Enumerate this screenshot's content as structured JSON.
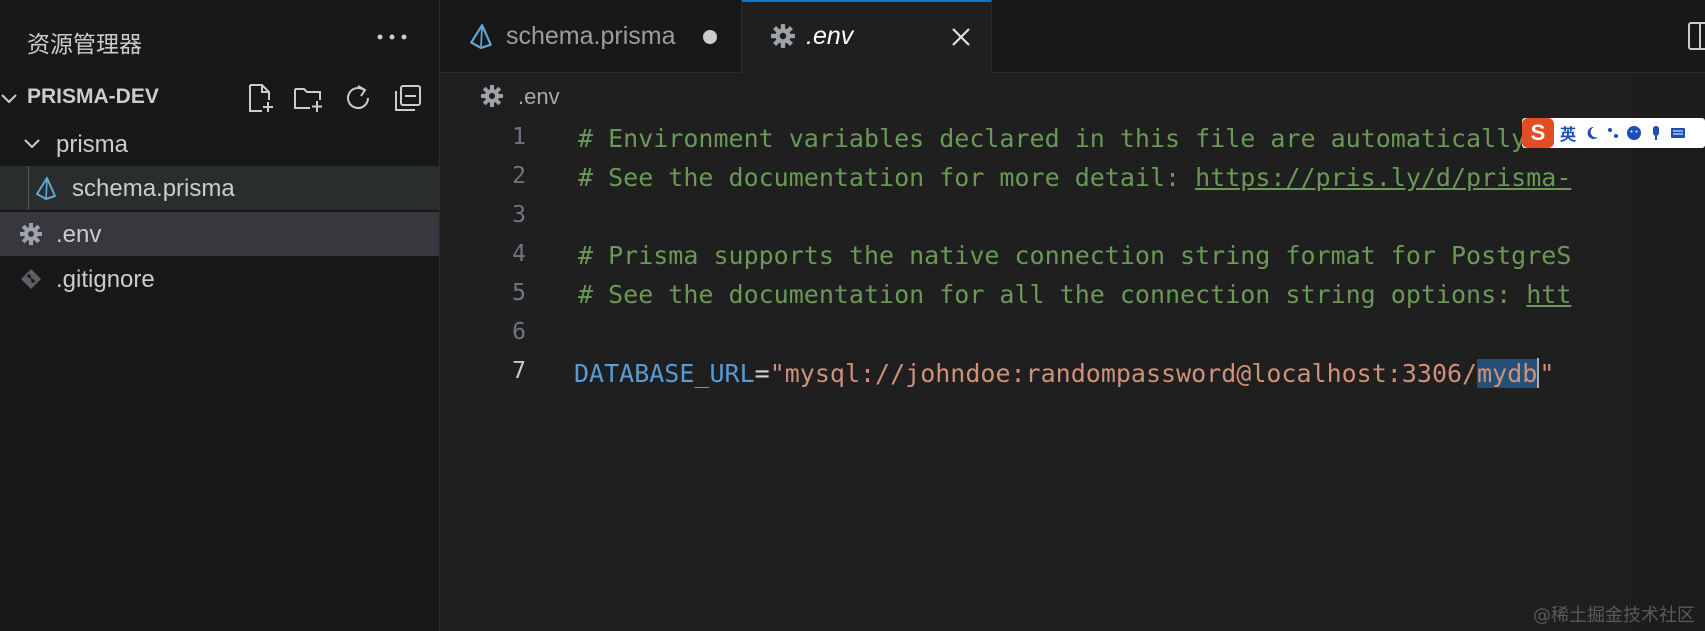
{
  "sidebar": {
    "title": "资源管理器",
    "folder": {
      "name": "PRISMA-DEV",
      "actions": [
        "new-file-icon",
        "new-folder-icon",
        "refresh-icon",
        "collapse-all-icon"
      ]
    },
    "items": [
      {
        "label": "prisma",
        "icon": "chevron-down-icon"
      },
      {
        "label": "schema.prisma",
        "icon": "prisma-icon"
      },
      {
        "label": ".env",
        "icon": "gear-icon"
      },
      {
        "label": ".gitignore",
        "icon": "git-icon"
      }
    ]
  },
  "tabs": [
    {
      "label": "schema.prisma",
      "icon": "prisma-icon",
      "dirty": true,
      "active": false
    },
    {
      "label": ".env",
      "icon": "gear-icon",
      "dirty": false,
      "active": true
    }
  ],
  "breadcrumb": {
    "label": ".env"
  },
  "editor": {
    "current_line": 7,
    "lines": [
      {
        "number": "1",
        "text": "# Environment variables declared in this file are automatically ma"
      },
      {
        "number": "2",
        "prefix": "# See the documentation for more detail: ",
        "url": "https://pris.ly/d/prisma-"
      },
      {
        "number": "3",
        "text": ""
      },
      {
        "number": "4",
        "text": "# Prisma supports the native connection string format for PostgreS"
      },
      {
        "number": "5",
        "prefix": "# See the documentation for all the connection string options: ",
        "url": "htt"
      },
      {
        "number": "6",
        "text": ""
      },
      {
        "number": "7",
        "key": "DATABASE_URL",
        "op": "=",
        "str_open": "\"mysql://johndoe:randompassword@localhost:3306/",
        "selected": "mydb",
        "str_close": "\""
      }
    ]
  },
  "ime": {
    "logo": "S",
    "lang": "英"
  },
  "watermark": "@稀土掘金技术社区",
  "colors": {
    "accent": "#0078d4",
    "comment": "#6a9955",
    "keyword": "#569cd6",
    "string": "#ce9178",
    "selection": "#264f78"
  }
}
